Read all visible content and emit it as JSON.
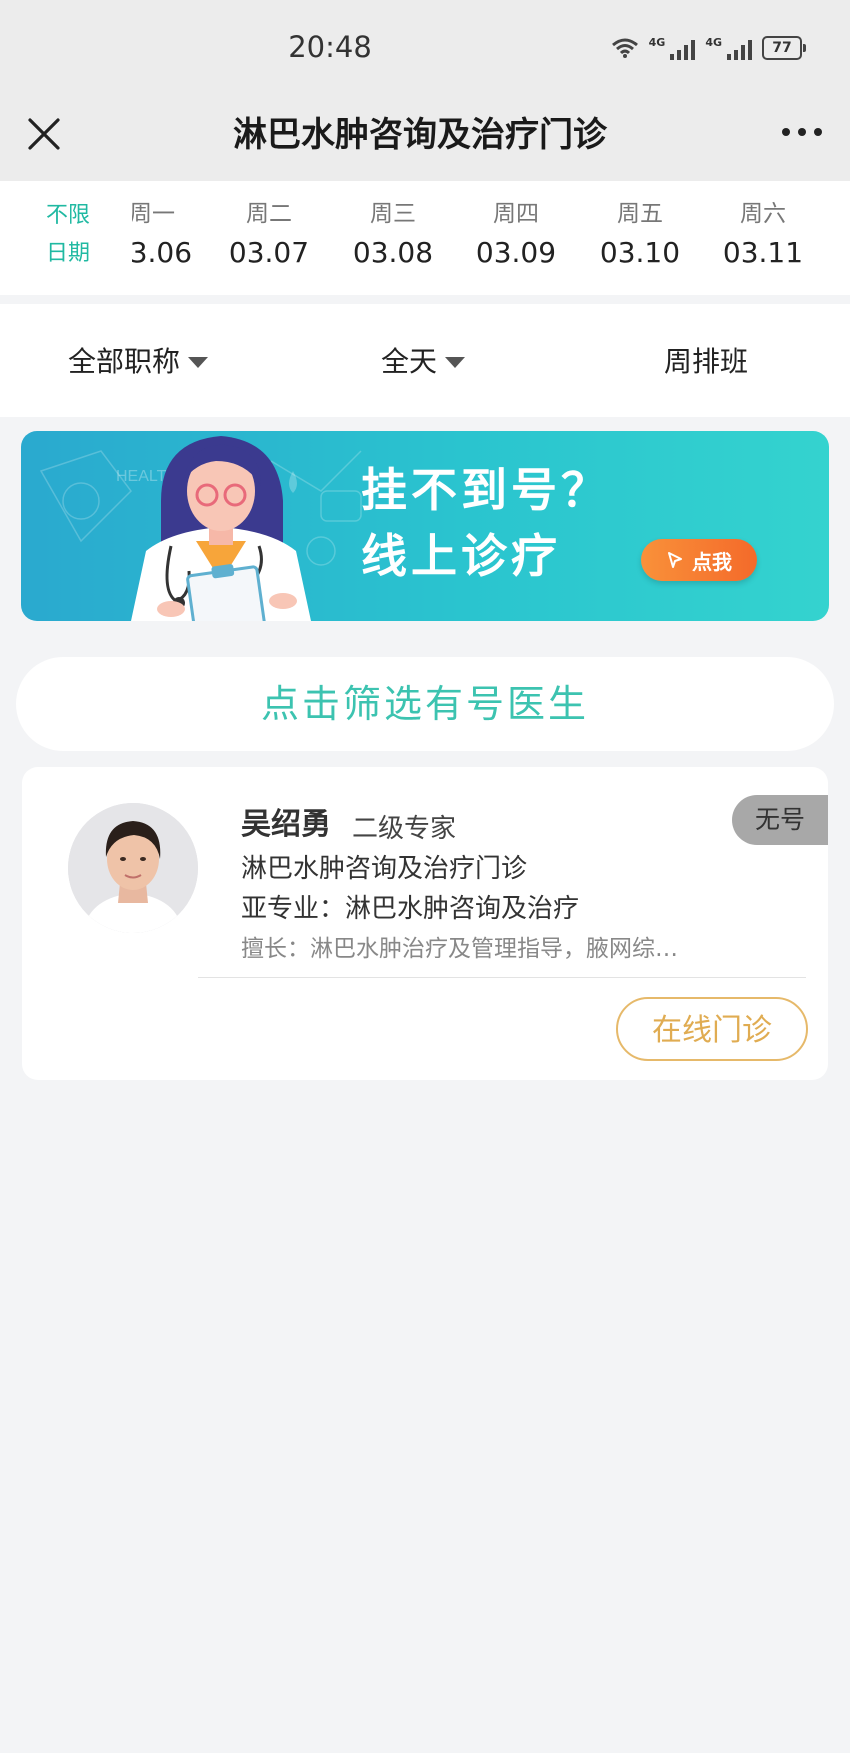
{
  "status_bar": {
    "time": "20:48",
    "network_1": "4G",
    "network_2": "4G",
    "battery": "77"
  },
  "nav": {
    "title": "淋巴水肿咨询及治疗门诊"
  },
  "date_strip": {
    "unlimited_line1": "不限",
    "unlimited_line2": "日期",
    "days": [
      {
        "weekday": "周一",
        "date": "03.06"
      },
      {
        "weekday": "周二",
        "date": "03.07"
      },
      {
        "weekday": "周三",
        "date": "03.08"
      },
      {
        "weekday": "周四",
        "date": "03.09"
      },
      {
        "weekday": "周五",
        "date": "03.10"
      },
      {
        "weekday": "周六",
        "date": "03.11"
      }
    ]
  },
  "filters": {
    "title_filter": "全部职称",
    "time_filter": "全天",
    "week_schedule": "周排班"
  },
  "banner": {
    "line1": "挂不到号？",
    "line2": "线上诊疗",
    "button": "点我",
    "watermark": "HEALTH"
  },
  "filter_available_button": "点击筛选有号医生",
  "doctor": {
    "name": "吴绍勇",
    "title": "二级专家",
    "department": "淋巴水肿咨询及治疗门诊",
    "subspecialty": "亚专业：淋巴水肿咨询及治疗",
    "expertise": "擅长：淋巴水肿治疗及管理指导，腋网综…",
    "availability": "无号",
    "online_button": "在线门诊"
  },
  "colors": {
    "accent": "#20b9a2",
    "banner": "#2ac4cf",
    "orange": "#f46a2a",
    "gold": "#e0ac52"
  }
}
